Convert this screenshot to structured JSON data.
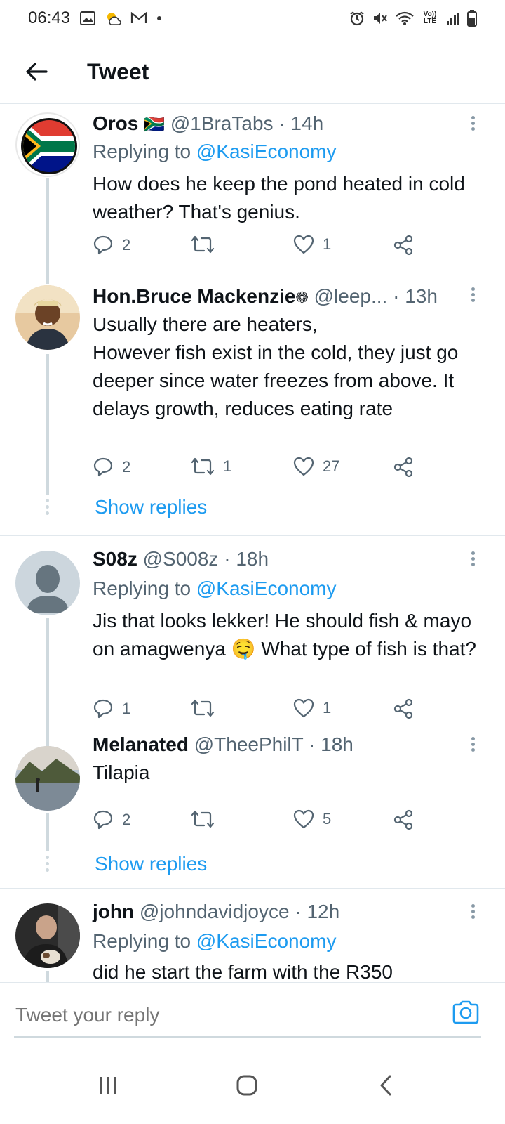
{
  "status_bar": {
    "time": "06:43",
    "network": "Vo)) LTE"
  },
  "header": {
    "title": "Tweet"
  },
  "replies": [
    {
      "name": "Oros",
      "flag": "🇿🇦",
      "handle": "@1BraTabs",
      "time": "14h",
      "replying_prefix": "Replying to",
      "replying_to": "@KasiEconomy",
      "text": "How does he keep the pond heated in cold weather? That's genius.",
      "replies": "2",
      "retweets": "",
      "likes": "1"
    },
    {
      "name": "Hon.Bruce Mackenzie",
      "flower": "❁",
      "handle": "@leep...",
      "time": "13h",
      "text_lines": [
        "Usually there are heaters,",
        "However fish exist in the cold, they just go deeper since water freezes from above. It delays growth, reduces eating rate"
      ],
      "replies": "2",
      "retweets": "1",
      "likes": "27",
      "show_replies": "Show replies"
    },
    {
      "name": "S08z",
      "handle": "@S008z",
      "time": "18h",
      "replying_prefix": "Replying to",
      "replying_to": "@KasiEconomy",
      "text_a": "Jis that looks lekker! He should fish & mayo on amagwenya",
      "emoji": "🤤",
      "text_b": "What type of fish is that?",
      "replies": "1",
      "retweets": "",
      "likes": "1"
    },
    {
      "name": "Melanated",
      "handle": "@TheePhilT",
      "time": "18h",
      "text": "Tilapia",
      "replies": "2",
      "retweets": "",
      "likes": "5",
      "show_replies": "Show replies"
    },
    {
      "name": "john",
      "handle": "@johndavidjoyce",
      "time": "12h",
      "replying_prefix": "Replying to",
      "replying_to": "@KasiEconomy",
      "text": "did he start the farm with the R350"
    }
  ],
  "reply_bar": {
    "placeholder": "Tweet your reply"
  },
  "colors": {
    "accent": "#1d9bf0",
    "secondary_text": "#536471",
    "thread_line": "#cfd9de"
  }
}
